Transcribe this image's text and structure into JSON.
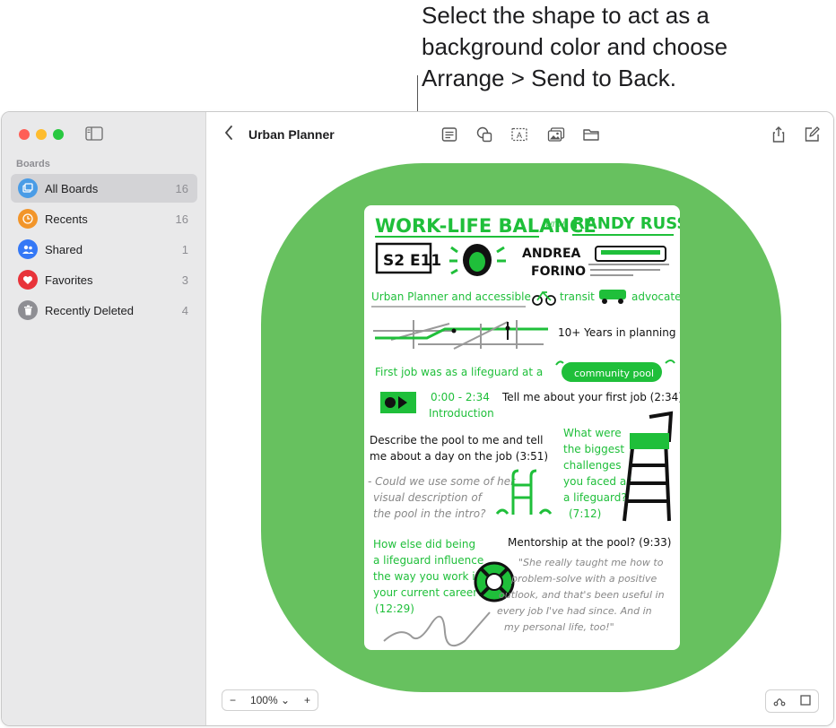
{
  "callout": {
    "line1": "Select the shape to act as a",
    "line2": "background color and choose",
    "line3": "Arrange > Send to Back."
  },
  "sidebar": {
    "section": "Boards",
    "items": [
      {
        "label": "All Boards",
        "count": "16",
        "icon": "all-boards-icon",
        "color": "#4a9ce6"
      },
      {
        "label": "Recents",
        "count": "16",
        "icon": "clock-icon",
        "color": "#f2952a"
      },
      {
        "label": "Shared",
        "count": "1",
        "icon": "people-icon",
        "color": "#3478f6"
      },
      {
        "label": "Favorites",
        "count": "3",
        "icon": "heart-icon",
        "color": "#e8333a"
      },
      {
        "label": "Recently Deleted",
        "count": "4",
        "icon": "trash-icon",
        "color": "#8e8e93"
      }
    ]
  },
  "toolbar": {
    "title": "Urban Planner",
    "icons": [
      "sticky-note-icon",
      "shapes-icon",
      "text-box-icon",
      "media-icon",
      "folder-icon",
      "share-icon",
      "compose-icon"
    ]
  },
  "board": {
    "shape_color": "#67c15f",
    "accent": "#1fbf3a",
    "card": {
      "title": "WORK-LIFE BALANCE",
      "with": "WITH",
      "host": "RANDY RUSSO",
      "episode": "S2 E11",
      "guest_first": "ANDREA",
      "guest_last": "FORINO",
      "line_role_a": "Urban Planner and accessible",
      "line_role_b": "transit",
      "line_role_c": "advocate",
      "years": "10+ Years in planning",
      "first_job_a": "First job was as a lifeguard at a",
      "first_job_b": "community pool",
      "time_intro": "0:00 - 2:34",
      "intro": "Introduction",
      "q1": "Tell me about your first job (2:34)",
      "q2a": "Describe the pool to me and tell",
      "q2b": "me about a day on the job (3:51)",
      "note1a": "- Could we use some of her",
      "note1b": "visual description of",
      "note1c": "the pool in the intro?",
      "q3a": "What were",
      "q3b": "the biggest",
      "q3c": "challenges",
      "q3d": "you faced as",
      "q3e": "a lifeguard?",
      "q3f": "(7:12)",
      "q4a": "How else did being",
      "q4b": "a lifeguard influence",
      "q4c": "the way you work in",
      "q4d": "your current career?",
      "q4e": "(12:29)",
      "q5": "Mentorship at the pool? (9:33)",
      "quote_a": "\"She really taught me how to",
      "quote_b": "problem-solve with a positive",
      "quote_c": "outlook, and that's been useful in",
      "quote_d": "every job I've had since. And in",
      "quote_e": "my personal life, too!\""
    }
  },
  "footer": {
    "zoom": "100%",
    "zoom_minus": "−",
    "zoom_plus": "+",
    "zoom_caret": "⌄"
  }
}
